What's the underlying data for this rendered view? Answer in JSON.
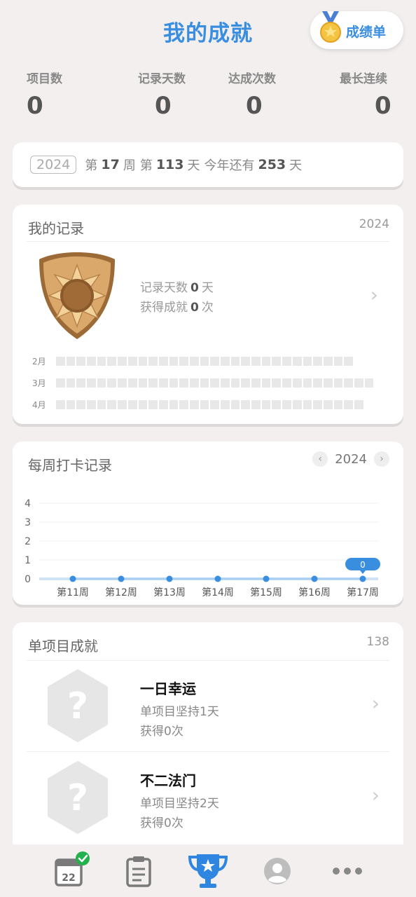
{
  "header": {
    "title": "我的成就",
    "report_label": "成绩单"
  },
  "stats": [
    {
      "label": "项目数",
      "value": "0"
    },
    {
      "label": "记录天数",
      "value": "0"
    },
    {
      "label": "达成次数",
      "value": "0"
    },
    {
      "label": "最长连续",
      "value": "0"
    }
  ],
  "day_info": {
    "year": "2024",
    "week_prefix": "第",
    "week_num": "17",
    "week_suffix": "周",
    "day_prefix": "第",
    "day_num": "113",
    "day_suffix": "天",
    "remain_prefix": "今年还有",
    "remain_num": "253",
    "remain_suffix": "天"
  },
  "my_record": {
    "title": "我的记录",
    "year": "2024",
    "days_label": "记录天数",
    "days_value": "0",
    "days_unit": "天",
    "ach_label": "获得成就",
    "ach_value": "0",
    "ach_unit": "次",
    "months": [
      "2月",
      "3月",
      "4月"
    ]
  },
  "weekly": {
    "title": "每周打卡记录",
    "year": "2024",
    "prev_icon": "chevron-left-icon",
    "next_icon": "chevron-right-icon"
  },
  "chart_data": {
    "type": "line",
    "categories": [
      "第11周",
      "第12周",
      "第13周",
      "第14周",
      "第15周",
      "第16周",
      "第17周"
    ],
    "values": [
      0,
      0,
      0,
      0,
      0,
      0,
      0
    ],
    "yticks": [
      "0",
      "1",
      "2",
      "3",
      "4"
    ],
    "ylim": [
      0,
      4
    ],
    "highlight_label": "0",
    "grid": true
  },
  "single": {
    "title": "单项目成就",
    "count": "138",
    "items": [
      {
        "name": "一日幸运",
        "desc": "单项目坚持1天",
        "got": "获得0次"
      },
      {
        "name": "不二法门",
        "desc": "单项目坚持2天",
        "got": "获得0次"
      }
    ]
  },
  "tabbar": {
    "calendar_day": "22"
  },
  "colors": {
    "accent": "#3a8ee0",
    "success": "#22b14c",
    "muted": "#999999"
  }
}
